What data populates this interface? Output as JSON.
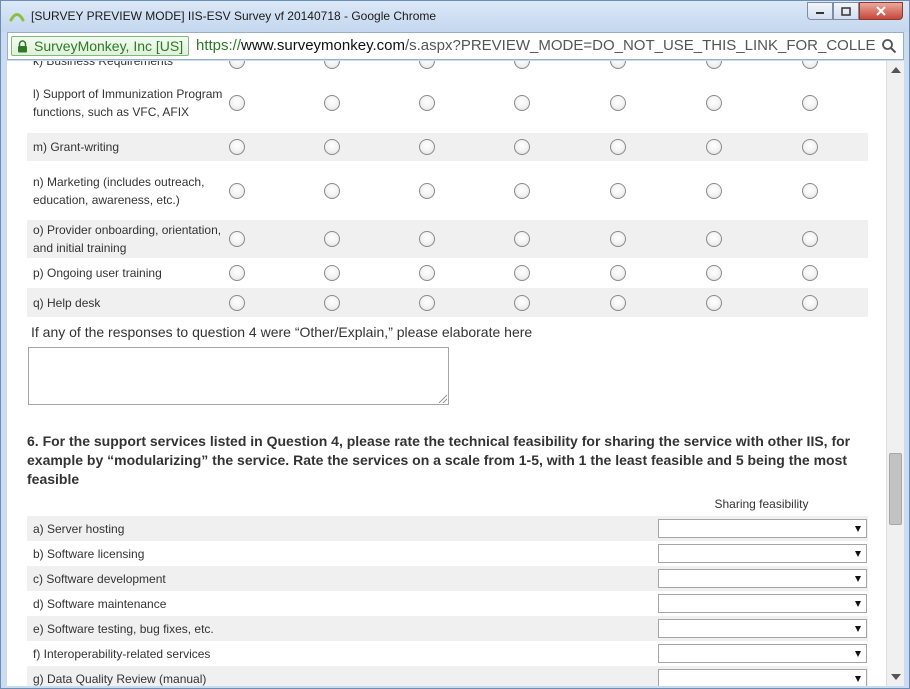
{
  "window": {
    "title": "[SURVEY PREVIEW MODE] IIS-ESV Survey vf 20140718 - Google Chrome",
    "controls": [
      "minimize",
      "maximize",
      "close"
    ]
  },
  "addressbar": {
    "ev_label": "SurveyMonkey, Inc [US]",
    "scheme": "https://",
    "host": "www.surveymonkey.com",
    "path": "/s.aspx?PREVIEW_MODE=DO_NOT_USE_THIS_LINK_FOR_COLLEC"
  },
  "grid": {
    "rows": [
      {
        "label": "k) Business Requirements",
        "shaded": false
      },
      {
        "label": "l) Support of Immunization Program functions, such as VFC, AFIX",
        "shaded": false
      },
      {
        "label": "m) Grant-writing",
        "shaded": true
      },
      {
        "label": "n) Marketing (includes outreach, education, awareness, etc.)",
        "shaded": false
      },
      {
        "label": "o) Provider onboarding, orientation, and initial training",
        "shaded": true
      },
      {
        "label": "p) Ongoing user training",
        "shaded": false
      },
      {
        "label": "q) Help desk",
        "shaded": true
      }
    ]
  },
  "elaborate": {
    "label": "If any of the responses to question 4 were “Other/Explain,” please elaborate here",
    "value": ""
  },
  "question6": {
    "text": "6. For the support services listed in Question 4, please rate the technical feasibility for sharing the service with other IIS, for example by “modularizing” the service. Rate the services on a scale from 1-5, with 1 the least feasible and 5 being the most feasible",
    "column_header": "Sharing feasibility",
    "rows": [
      {
        "label": "a) Server hosting",
        "value": "",
        "shaded": true
      },
      {
        "label": "b) Software licensing",
        "value": "",
        "shaded": false
      },
      {
        "label": "c) Software development",
        "value": "",
        "shaded": true
      },
      {
        "label": "d) Software maintenance",
        "value": "",
        "shaded": false
      },
      {
        "label": "e) Software testing, bug fixes, etc.",
        "value": "",
        "shaded": true
      },
      {
        "label": "f) Interoperability-related services",
        "value": "",
        "shaded": false
      },
      {
        "label": "g) Data Quality Review (manual)",
        "value": "",
        "shaded": true
      }
    ]
  }
}
